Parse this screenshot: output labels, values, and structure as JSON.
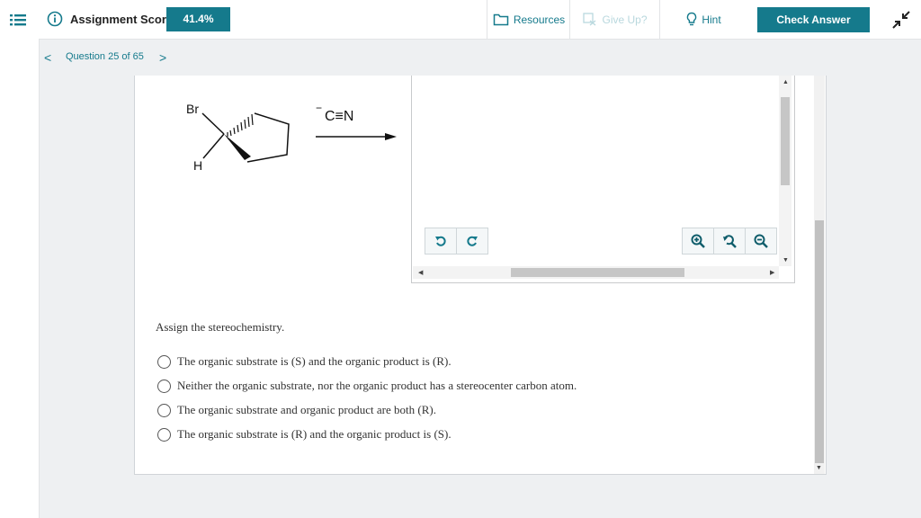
{
  "header": {
    "assignment_score_label": "Assignment Score:",
    "assignment_score_value": "41.4%",
    "resources_label": "Resources",
    "give_up_label": "Give Up?",
    "hint_label": "Hint",
    "check_answer_label": "Check Answer"
  },
  "question_nav": {
    "label": "Question 25 of 65",
    "prev": "<",
    "next": ">"
  },
  "reaction": {
    "substituent_top": "Br",
    "substituent_bottom": "H",
    "reagent": "C≡N",
    "reagent_charge": "−"
  },
  "question": {
    "prompt": "Assign the stereochemistry.",
    "options": [
      {
        "text": "The organic substrate is (S) and the organic product is (R)."
      },
      {
        "text": "Neither the organic substrate, nor the organic product has a stereocenter carbon atom."
      },
      {
        "text": "The organic substrate and organic product are both (R)."
      },
      {
        "text": "The organic substrate is (R) and the organic product is (S)."
      }
    ]
  },
  "colors": {
    "accent": "#157a8c",
    "give_up_disabled": "#b9d8de"
  },
  "icons": [
    "menu-icon",
    "info-icon",
    "folder-icon",
    "give-up-icon",
    "lightbulb-icon",
    "collapse-icon",
    "undo-icon",
    "redo-icon",
    "zoom-in-icon",
    "reset-zoom-icon",
    "zoom-out-icon"
  ]
}
